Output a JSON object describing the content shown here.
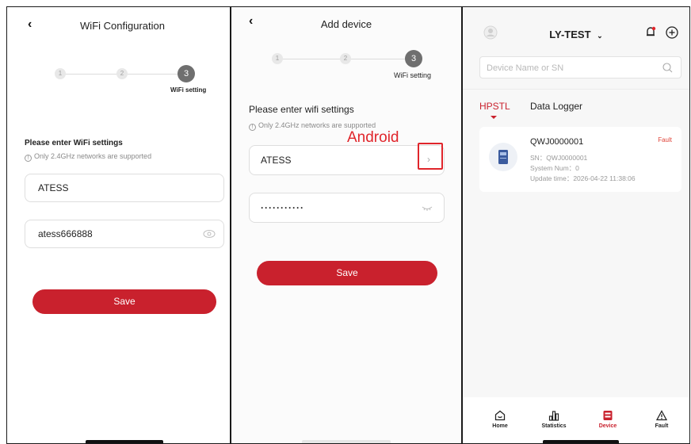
{
  "panel1": {
    "title": "WiFi Configuration",
    "back_glyph": "‹",
    "steps": [
      "1",
      "2",
      "3"
    ],
    "active_step_label": "WiFi setting",
    "section_title": "Please enter WiFi settings",
    "note": "Only 2.4GHz networks are supported",
    "ssid_value": "ATESS",
    "password_value": "atess666888",
    "save_label": "Save"
  },
  "panel2": {
    "title": "Add device",
    "back_glyph": "‹",
    "steps": [
      "1",
      "2",
      "3"
    ],
    "active_step_label": "WiFi setting",
    "section_title": "Please enter wifi settings",
    "note": "Only 2.4GHz networks are supported",
    "annotation": "Android",
    "ssid_value": "ATESS",
    "password_masked": "···········",
    "save_label": "Save"
  },
  "panel3": {
    "title": "LY-TEST",
    "search_placeholder": "Device Name or SN",
    "tabs": [
      "HPSTL",
      "Data Logger"
    ],
    "device": {
      "name": "QWJ0000001",
      "status": "Fault",
      "sn": "SN：QWJ0000001",
      "system_num": "System Num：0",
      "update_time": "Update time：2026-04-22 11:38:06"
    },
    "nav": [
      "Home",
      "Statistics",
      "Device",
      "Fault"
    ]
  },
  "colors": {
    "accent": "#c9212d",
    "step_active": "#6f6f6f"
  }
}
